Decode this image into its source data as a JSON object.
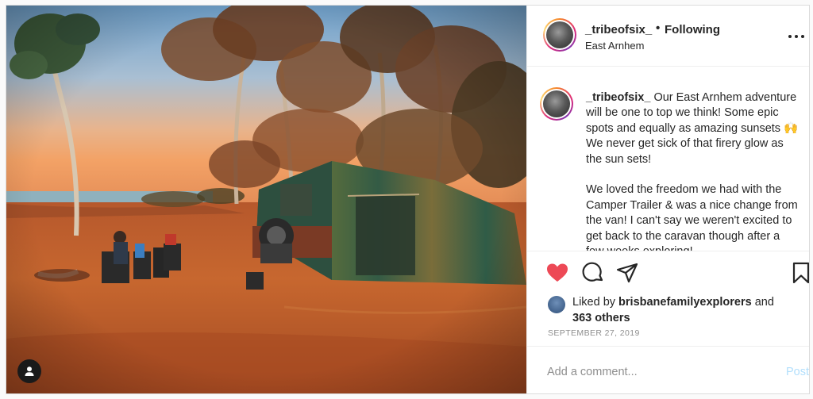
{
  "header": {
    "username": "_tribeofsix_",
    "separator": "•",
    "follow_status": "Following",
    "location": "East Arnhem"
  },
  "caption": {
    "username": "_tribeofsix_",
    "paragraph1": "Our East Arnhem adventure will be one to top we think! Some epic spots and equally as amazing sunsets 🙌 We never get sick of that firery glow as the sun sets!",
    "paragraph2": "We loved the freedom we had with the Camper Trailer & was a nice change from the van! I can't say we weren't excited to get back to the caravan though after a few weeks exploring!"
  },
  "actions": {
    "like_icon": "heart-filled-icon",
    "comment_icon": "comment-icon",
    "share_icon": "share-icon",
    "save_icon": "bookmark-icon",
    "like_color": "#ed4956"
  },
  "likes": {
    "prefix": "Liked by",
    "liker": "brisbanefamilyexplorers",
    "conjunction": "and",
    "others": "363 others"
  },
  "date": "SEPTEMBER 27, 2019",
  "comment": {
    "placeholder": "Add a comment...",
    "post_label": "Post"
  },
  "colors": {
    "accent_blue": "#b2dffc",
    "muted": "#8e8e8e",
    "text": "#262626"
  }
}
